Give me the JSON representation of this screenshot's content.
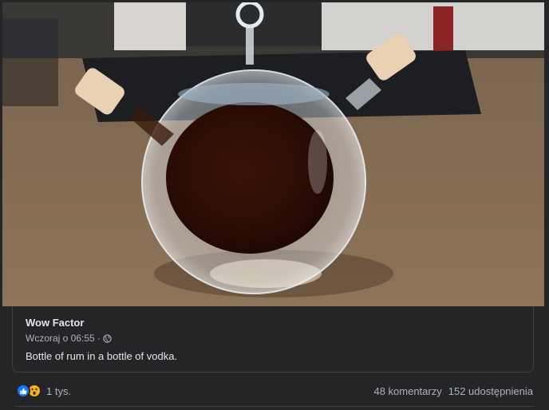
{
  "post": {
    "author": "Wow Factor",
    "time": "Wczoraj o 06:55",
    "separator": "·",
    "caption": "Bottle of rum in a bottle of vodka."
  },
  "footer": {
    "reactions_count": "1 tys.",
    "comments": "48 komentarzy",
    "shares": "152 udostępnienia"
  },
  "icons": {
    "like": "like-icon",
    "wow": "wow-icon",
    "audience": "globe-icon"
  },
  "colors": {
    "background": "#242526",
    "like": "#1877f2",
    "wow": "#f7b125",
    "primary_text": "#e4e6eb",
    "secondary_text": "#b0b3b8"
  }
}
